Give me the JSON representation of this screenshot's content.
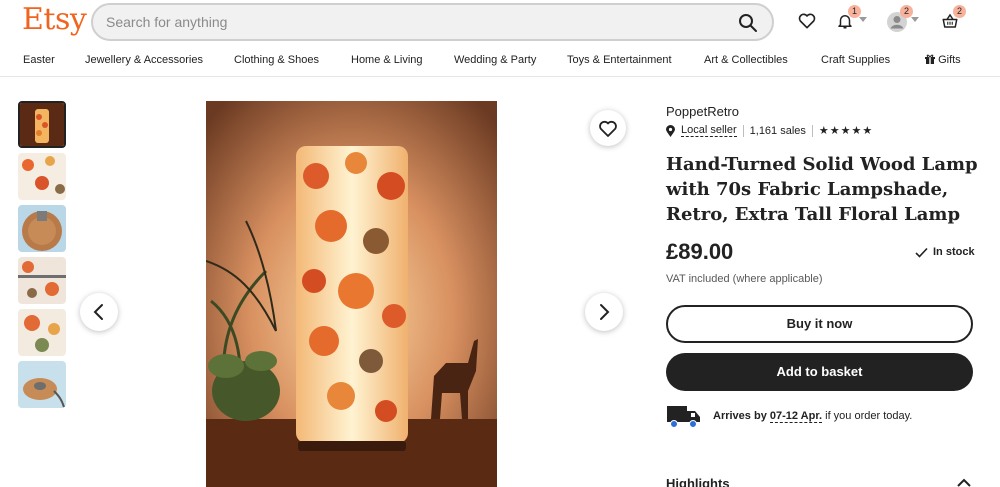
{
  "header": {
    "logo": "Etsy",
    "search_placeholder": "Search for anything",
    "notifications_count": "1",
    "account_count": "2",
    "basket_count": "2"
  },
  "nav": {
    "items": [
      "Easter",
      "Jewellery & Accessories",
      "Clothing & Shoes",
      "Home & Living",
      "Wedding & Party",
      "Toys & Entertainment",
      "Art & Collectibles",
      "Craft Supplies",
      "Gifts"
    ]
  },
  "listing": {
    "shop_name": "PoppetRetro",
    "local_seller": "Local seller",
    "sales": "1,161 sales",
    "rating": "★★★★★",
    "title": "Hand-Turned Solid Wood Lamp with 70s Fabric Lampshade, Retro, Extra Tall Floral Lamp",
    "price": "£89.00",
    "stock": "In stock",
    "vat": "VAT included (where applicable)",
    "buy_now": "Buy it now",
    "add_to_basket": "Add to basket",
    "arrives_prefix": "Arrives by",
    "arrives_dates": "07-12 Apr.",
    "arrives_suffix": "if you order today.",
    "highlights": "Highlights"
  },
  "colors": {
    "brand": "#f1641e",
    "badge": "#f8b19b",
    "primary_button": "#222222"
  }
}
